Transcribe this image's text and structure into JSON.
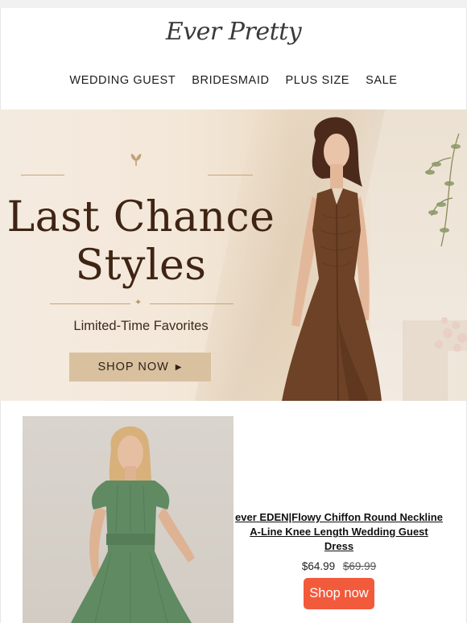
{
  "brand": {
    "logo_text": "Ever Pretty"
  },
  "nav": {
    "items": [
      {
        "label": "WEDDING GUEST"
      },
      {
        "label": "BRIDESMAID"
      },
      {
        "label": "PLUS SIZE"
      },
      {
        "label": "SALE"
      }
    ]
  },
  "hero": {
    "title_line1": "Last Chance",
    "title_line2": "Styles",
    "subtitle": "Limited-Time Favorites",
    "cta_label": "SHOP NOW",
    "cta_icon": "play-triangle-icon",
    "ornament_icon": "leaf-sprig-icon",
    "dress_color": "#6e4226",
    "accent_color": "#d9c1a0"
  },
  "product": {
    "title": "ever EDEN|Flowy Chiffon Round Neckline A-Line Knee Length Wedding Guest Dress",
    "price_now": "$64.99",
    "price_old": "$69.99",
    "button_label": "Shop now",
    "button_color": "#f25a3c",
    "dress_color": "#5f8a62"
  }
}
